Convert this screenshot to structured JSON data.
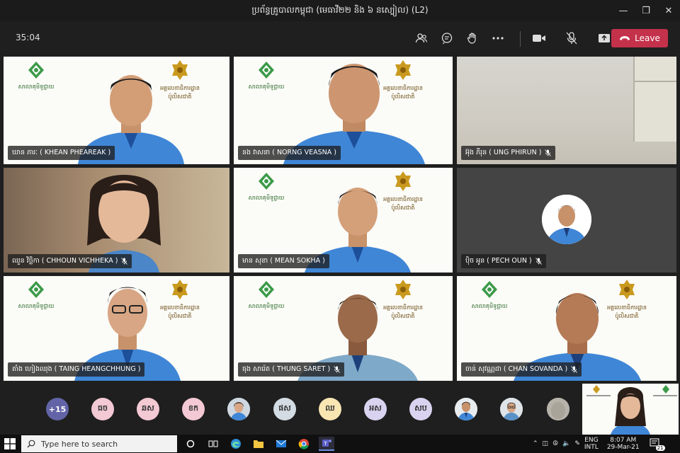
{
  "window": {
    "title": "ប្រព័ន្ធគ្រូបាលកម្ពុជា (មេធាវី២២ និង ៦ នស្បៀល) (L2)",
    "minimize_icon": "minimize-icon",
    "maximize_icon": "restore-icon",
    "close_icon": "close-icon"
  },
  "toolbar": {
    "timer": "35:04",
    "leave_label": "Leave",
    "leave_color": "#c4314b",
    "icons": [
      "participants-icon",
      "chat-icon",
      "raise-hand-icon",
      "more-icon",
      "camera-icon",
      "mic-off-icon",
      "share-icon"
    ]
  },
  "participants": [
    {
      "name": "ឃាន ភារៈ ( KHEAN PHEAREAK )",
      "muted": false
    },
    {
      "name": "នង វាសនា ( NORNG VEASNA )",
      "muted": false
    },
    {
      "name": "អ៊ុង ភីរុន ( UNG PHIRUN )",
      "muted": true
    },
    {
      "name": "ឈួន វិច្ឆិកា ( CHHOUN VICHHEKA )",
      "muted": true
    },
    {
      "name": "មាន សុខា ( MEAN SOKHA )",
      "muted": false
    },
    {
      "name": "ប៉ិច អូន ( PECH OUN )",
      "muted": true
    },
    {
      "name": "តាំង ហៀងឈុង ( TAING HEANGCHHUNG )",
      "muted": false
    },
    {
      "name": "ធុង សារ៉េត ( THUNG SARET )",
      "muted": true
    },
    {
      "name": "ចាន់ សុវណ្ណដា ( CHAN SOVANDA )",
      "muted": true
    }
  ],
  "logos": {
    "left_caption": "សាលាគុមិទូជ្ជាយ",
    "right_caption_1": "អគ្គលេខាធិការដ្ឋាន",
    "right_caption_2": "ប៉ូលិសជាតិ"
  },
  "overflow": {
    "more_count": "+15",
    "chips": [
      {
        "initials": "ធច",
        "color": "#f3c9d4"
      },
      {
        "initials": "ឆស",
        "color": "#f3c9d4"
      },
      {
        "initials": "ខក",
        "color": "#f3c9d4"
      },
      {
        "initials": "",
        "color": "#b8c4cf"
      },
      {
        "initials": "ផស",
        "color": "#d3dbe3"
      },
      {
        "initials": "ឈ",
        "color": "#f8e6b3"
      },
      {
        "initials": "អស",
        "color": "#d9d3f0"
      },
      {
        "initials": "សប",
        "color": "#d9d3f0"
      },
      {
        "initials": "",
        "color": "#b8c4cf"
      },
      {
        "initials": "",
        "color": "#b8c4cf"
      },
      {
        "initials": "",
        "color": "#b8c4cf"
      }
    ],
    "more_color": "#6264a7"
  },
  "taskbar": {
    "search_placeholder": "Type here to search",
    "lang": "ENG",
    "layout": "INTL",
    "time": "8:07 AM",
    "date": "29-Mar-21",
    "notifications": "21"
  }
}
